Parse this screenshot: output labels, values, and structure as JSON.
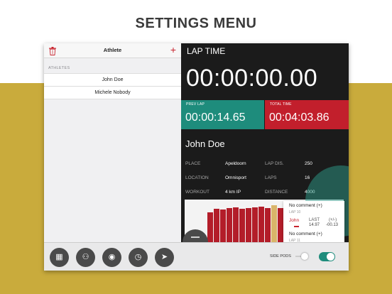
{
  "headline": "SETTINGS MENU",
  "colors": {
    "accent_red": "#c8242f",
    "teal": "#1e8c7c",
    "gold": "#c9ab3c",
    "panel_dark": "#1b1b1b"
  },
  "left_panel": {
    "title": "Athlete",
    "delete_icon": "trash-icon",
    "add_icon": "plus-icon",
    "section_header": "ATHLETES",
    "athletes": [
      "John Doe",
      "Michele Nobody"
    ]
  },
  "timer": {
    "title": "LAP TIME",
    "lap_time": "00:00:00.00",
    "prev_lap_label": "PREV LAP",
    "prev_lap": "00:00:14.65",
    "total_time_label": "TOTAL TIME",
    "total_time": "00:04:03.86"
  },
  "athlete_details": {
    "name": "John Doe",
    "place_label": "PLACE",
    "place": "Apeldoorn",
    "location_label": "LOCATION",
    "location": "Omnisport",
    "workout_label": "WORKOUT",
    "workout": "4 km IP",
    "lap_dis_label": "LAP DIS.",
    "lap_dis": "250",
    "laps_label": "LAPS",
    "laps": "16",
    "distance_label": "DISTANCE",
    "distance": "4000"
  },
  "chart_data": {
    "type": "bar",
    "values": [
      80,
      90,
      88,
      92,
      95,
      90,
      93,
      94,
      96,
      92,
      100,
      92,
      94,
      91,
      90,
      89
    ],
    "highlight_index": 10
  },
  "lap_popup": {
    "comment_1": "No comment (+)",
    "lap_1": "LAP 10",
    "name": "John",
    "last_label": "LAST",
    "diff_label": "(+/-)",
    "last_value": "14.97",
    "diff_value": "-00.13",
    "comment_2": "No comment (+)",
    "lap_2": "LAP 11"
  },
  "toolbar": {
    "buttons": [
      "calendar-icon",
      "team-icon",
      "location-pin-icon",
      "stopwatch-icon",
      "send-icon"
    ],
    "glyphs": [
      "▦",
      "⚇",
      "◉",
      "◷",
      "➤"
    ],
    "side_pods_label": "SIDE PODS",
    "side_pods_value": 1,
    "toggle_on": true
  }
}
